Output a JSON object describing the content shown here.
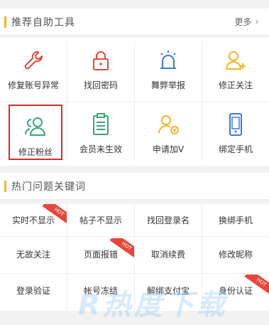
{
  "tools_section": {
    "title": "推荐自助工具",
    "more_label": "更多",
    "items": [
      {
        "label": "修复账号异常",
        "icon": "wrench-icon"
      },
      {
        "label": "找回密码",
        "icon": "lock-icon"
      },
      {
        "label": "舞弊举报",
        "icon": "alarm-icon"
      },
      {
        "label": "修正关注",
        "icon": "user-add-icon"
      },
      {
        "label": "修正粉丝",
        "icon": "users-icon",
        "selected": true
      },
      {
        "label": "会员未生效",
        "icon": "clipboard-icon"
      },
      {
        "label": "申请加V",
        "icon": "user-verify-icon"
      },
      {
        "label": "绑定手机",
        "icon": "phone-icon"
      }
    ]
  },
  "keywords_section": {
    "title": "热门问题关键词",
    "hot_badge": "HOT",
    "items": [
      {
        "label": "实时不显示",
        "hot": true
      },
      {
        "label": "帖子不显示",
        "hot": false
      },
      {
        "label": "找回登录名",
        "hot": false
      },
      {
        "label": "换绑手机",
        "hot": false
      },
      {
        "label": "无故关注",
        "hot": false
      },
      {
        "label": "页面报错",
        "hot": true
      },
      {
        "label": "取消续费",
        "hot": false
      },
      {
        "label": "修改昵称",
        "hot": false
      },
      {
        "label": "登录验证",
        "hot": false
      },
      {
        "label": "帐号冻结",
        "hot": false
      },
      {
        "label": "解绑支付宝",
        "hot": false
      },
      {
        "label": "身份认证",
        "hot": true
      }
    ]
  },
  "watermark": "R热度下载",
  "colors": {
    "accent_bar": "#f0b429",
    "red": "#e5483a",
    "green": "#3aa57b",
    "orange": "#f0b429",
    "blue": "#3a7bd5"
  }
}
